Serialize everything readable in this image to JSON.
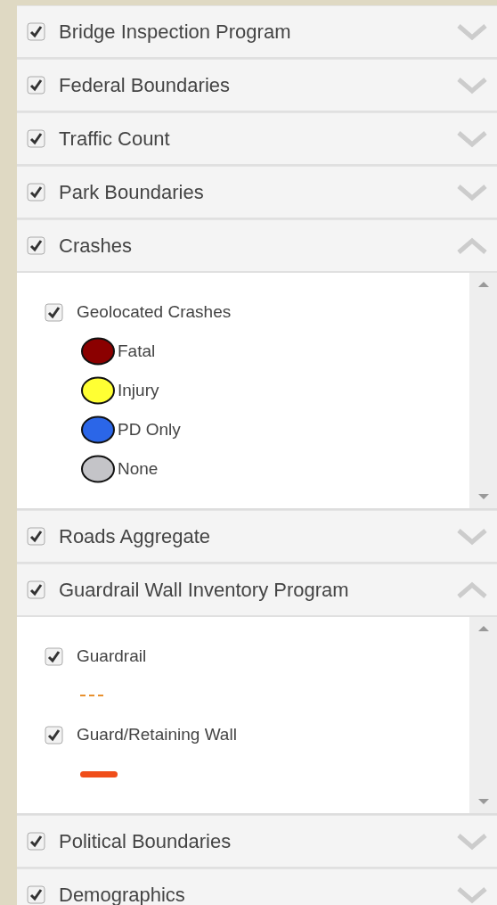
{
  "layers": [
    {
      "label": "Bridge Inspection Program",
      "checked": true,
      "expanded": false
    },
    {
      "label": "Federal Boundaries",
      "checked": true,
      "expanded": false
    },
    {
      "label": "Traffic Count",
      "checked": true,
      "expanded": false
    },
    {
      "label": "Park Boundaries",
      "checked": true,
      "expanded": false
    },
    {
      "label": "Crashes",
      "checked": true,
      "expanded": true,
      "sublayers": [
        {
          "label": "Geolocated Crashes",
          "checked": true,
          "legend": [
            {
              "kind": "circle",
              "color": "#8b0000",
              "label": "Fatal"
            },
            {
              "kind": "circle",
              "color": "#ffff33",
              "label": "Injury"
            },
            {
              "kind": "circle",
              "color": "#2b66e8",
              "label": "PD Only"
            },
            {
              "kind": "circle",
              "color": "#c4c4c8",
              "label": "None"
            }
          ]
        }
      ]
    },
    {
      "label": "Roads Aggregate",
      "checked": true,
      "expanded": false
    },
    {
      "label": "Guardrail Wall Inventory Program",
      "checked": true,
      "expanded": true,
      "sublayers": [
        {
          "label": "Guardrail",
          "checked": true,
          "legend": [
            {
              "kind": "dashed-line",
              "color": "#e8902e"
            }
          ]
        },
        {
          "label": "Guard/Retaining Wall",
          "checked": true,
          "legend": [
            {
              "kind": "solid-line",
              "color": "#f04e1a"
            }
          ]
        }
      ]
    },
    {
      "label": "Political Boundaries",
      "checked": true,
      "expanded": false
    },
    {
      "label": "Demographics",
      "checked": true,
      "expanded": false
    }
  ]
}
